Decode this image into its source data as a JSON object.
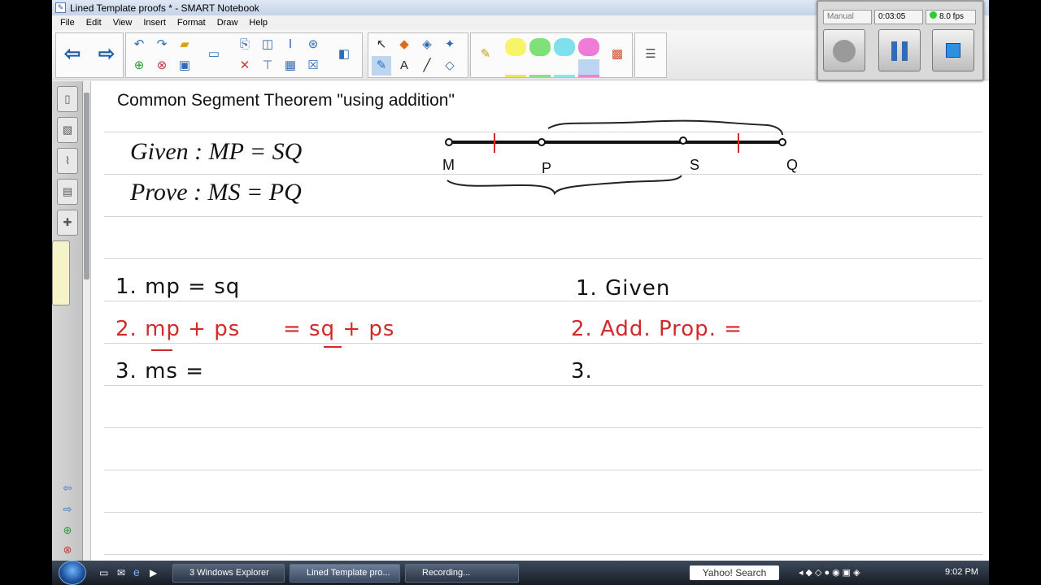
{
  "window": {
    "title": "Lined Template proofs * - SMART Notebook"
  },
  "menu": [
    "File",
    "Edit",
    "View",
    "Insert",
    "Format",
    "Draw",
    "Help"
  ],
  "recorder": {
    "mode": "Manual",
    "time": "0:03:05",
    "fps": "8.0 fps"
  },
  "page": {
    "title": "Common Segment Theorem \"using addition\"",
    "given": "Given : MP = SQ",
    "prove": "Prove : MS = PQ",
    "points": [
      "M",
      "P",
      "S",
      "Q"
    ]
  },
  "proof": {
    "statements": [
      "1. mp = sq",
      "2. mp + ps",
      "= sq + ps",
      "3. ms ="
    ],
    "reasons": [
      "1. Given",
      "2. Add. Prop. =",
      "3."
    ]
  },
  "taskbar": {
    "tasks": [
      "3 Windows Explorer",
      "Lined Template pro...",
      "Recording..."
    ],
    "search": "Yahoo! Search",
    "clock": "9:02 PM"
  },
  "colors": {
    "red_ink": "#d12a2a",
    "accent": "#2f6cb5"
  }
}
